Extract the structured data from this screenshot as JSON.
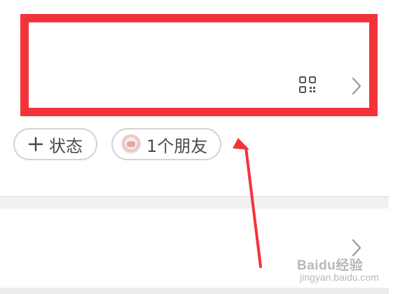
{
  "highlight": {
    "color": "#f2333a"
  },
  "profile_row": {
    "qr_icon": "qr-code-icon",
    "chevron_icon": "chevron-right-icon"
  },
  "chips": {
    "status": {
      "icon": "plus-icon",
      "label": "状态"
    },
    "friends": {
      "icon": "avatar",
      "label": "1个朋友"
    }
  },
  "lower_row": {
    "chevron_icon": "chevron-right-icon"
  },
  "watermark": {
    "main": "Baidu经验",
    "sub": "jingyan.baidu.com"
  }
}
